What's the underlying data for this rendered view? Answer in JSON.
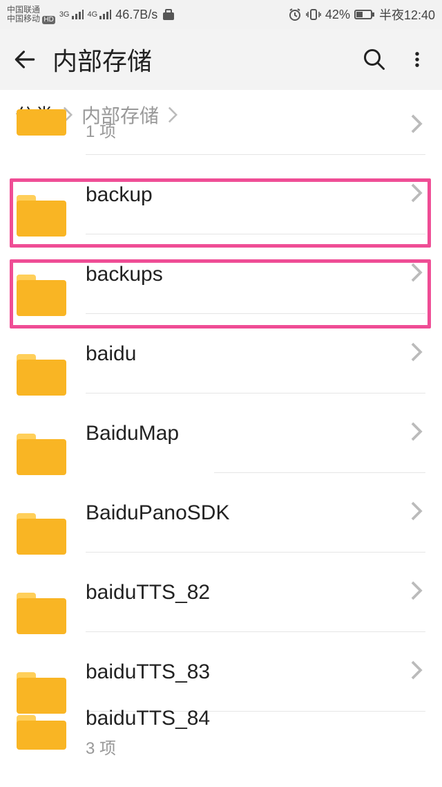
{
  "status": {
    "carrier1": "中国联通",
    "carrier2": "中国移动",
    "hd": "HD",
    "net1": "3G",
    "net2": "4G",
    "speed": "46.7B/s",
    "battery_pct": "42%",
    "time": "半夜12:40"
  },
  "appbar": {
    "title": "内部存储"
  },
  "breadcrumb": {
    "root": "分类",
    "current": "内部存储"
  },
  "folders": [
    {
      "name": "",
      "sub": "1 项"
    },
    {
      "name": "backup",
      "sub": ""
    },
    {
      "name": "backups",
      "sub": ""
    },
    {
      "name": "baidu",
      "sub": ""
    },
    {
      "name": "BaiduMap",
      "sub": ""
    },
    {
      "name": "BaiduPanoSDK",
      "sub": ""
    },
    {
      "name": "baiduTTS_82",
      "sub": ""
    },
    {
      "name": "baiduTTS_83",
      "sub": ""
    },
    {
      "name": "baiduTTS_84",
      "sub": "3 项"
    }
  ]
}
